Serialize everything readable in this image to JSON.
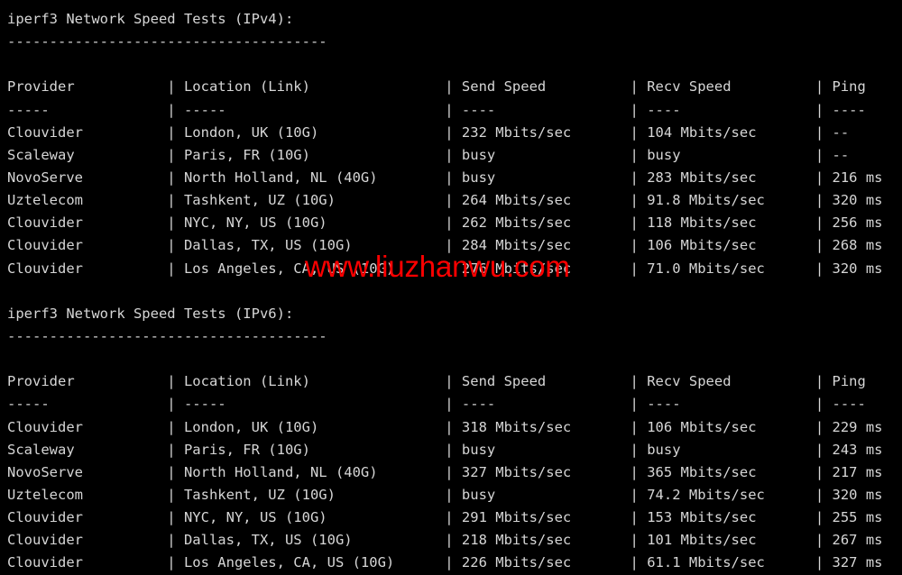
{
  "terminal": {
    "background_color": "#000000",
    "text_color": "#d6d6d6",
    "watermark": {
      "text": "www.liuzhanwu.com",
      "color": "#fe0000"
    },
    "columns": {
      "provider_width": 19,
      "location_width": 31,
      "send_width": 20,
      "recv_width": 20,
      "separator": "|"
    },
    "sections": [
      {
        "title": "iperf3 Network Speed Tests (IPv4):",
        "rule": "--------------------------------------",
        "headers": [
          "Provider",
          "Location (Link)",
          "Send Speed",
          "Recv Speed",
          "Ping"
        ],
        "header_rules": [
          "-----",
          "-----",
          "----",
          "----",
          "----"
        ],
        "rows": [
          {
            "provider": "Clouvider",
            "location": "London, UK (10G)",
            "send": "232 Mbits/sec",
            "recv": "104 Mbits/sec",
            "ping": "--"
          },
          {
            "provider": "Scaleway",
            "location": "Paris, FR (10G)",
            "send": "busy",
            "recv": "busy",
            "ping": "--"
          },
          {
            "provider": "NovoServe",
            "location": "North Holland, NL (40G)",
            "send": "busy",
            "recv": "283 Mbits/sec",
            "ping": "216 ms"
          },
          {
            "provider": "Uztelecom",
            "location": "Tashkent, UZ (10G)",
            "send": "264 Mbits/sec",
            "recv": "91.8 Mbits/sec",
            "ping": "320 ms"
          },
          {
            "provider": "Clouvider",
            "location": "NYC, NY, US (10G)",
            "send": "262 Mbits/sec",
            "recv": "118 Mbits/sec",
            "ping": "256 ms"
          },
          {
            "provider": "Clouvider",
            "location": "Dallas, TX, US (10G)",
            "send": "284 Mbits/sec",
            "recv": "106 Mbits/sec",
            "ping": "268 ms"
          },
          {
            "provider": "Clouvider",
            "location": "Los Angeles, CA, US (10G)",
            "send": "276 Mbits/sec",
            "recv": "71.0 Mbits/sec",
            "ping": "320 ms"
          }
        ]
      },
      {
        "title": "iperf3 Network Speed Tests (IPv6):",
        "rule": "--------------------------------------",
        "headers": [
          "Provider",
          "Location (Link)",
          "Send Speed",
          "Recv Speed",
          "Ping"
        ],
        "header_rules": [
          "-----",
          "-----",
          "----",
          "----",
          "----"
        ],
        "rows": [
          {
            "provider": "Clouvider",
            "location": "London, UK (10G)",
            "send": "318 Mbits/sec",
            "recv": "106 Mbits/sec",
            "ping": "229 ms"
          },
          {
            "provider": "Scaleway",
            "location": "Paris, FR (10G)",
            "send": "busy",
            "recv": "busy",
            "ping": "243 ms"
          },
          {
            "provider": "NovoServe",
            "location": "North Holland, NL (40G)",
            "send": "327 Mbits/sec",
            "recv": "365 Mbits/sec",
            "ping": "217 ms"
          },
          {
            "provider": "Uztelecom",
            "location": "Tashkent, UZ (10G)",
            "send": "busy",
            "recv": "74.2 Mbits/sec",
            "ping": "320 ms"
          },
          {
            "provider": "Clouvider",
            "location": "NYC, NY, US (10G)",
            "send": "291 Mbits/sec",
            "recv": "153 Mbits/sec",
            "ping": "255 ms"
          },
          {
            "provider": "Clouvider",
            "location": "Dallas, TX, US (10G)",
            "send": "218 Mbits/sec",
            "recv": "101 Mbits/sec",
            "ping": "267 ms"
          },
          {
            "provider": "Clouvider",
            "location": "Los Angeles, CA, US (10G)",
            "send": "226 Mbits/sec",
            "recv": "61.1 Mbits/sec",
            "ping": "327 ms"
          }
        ]
      }
    ]
  }
}
